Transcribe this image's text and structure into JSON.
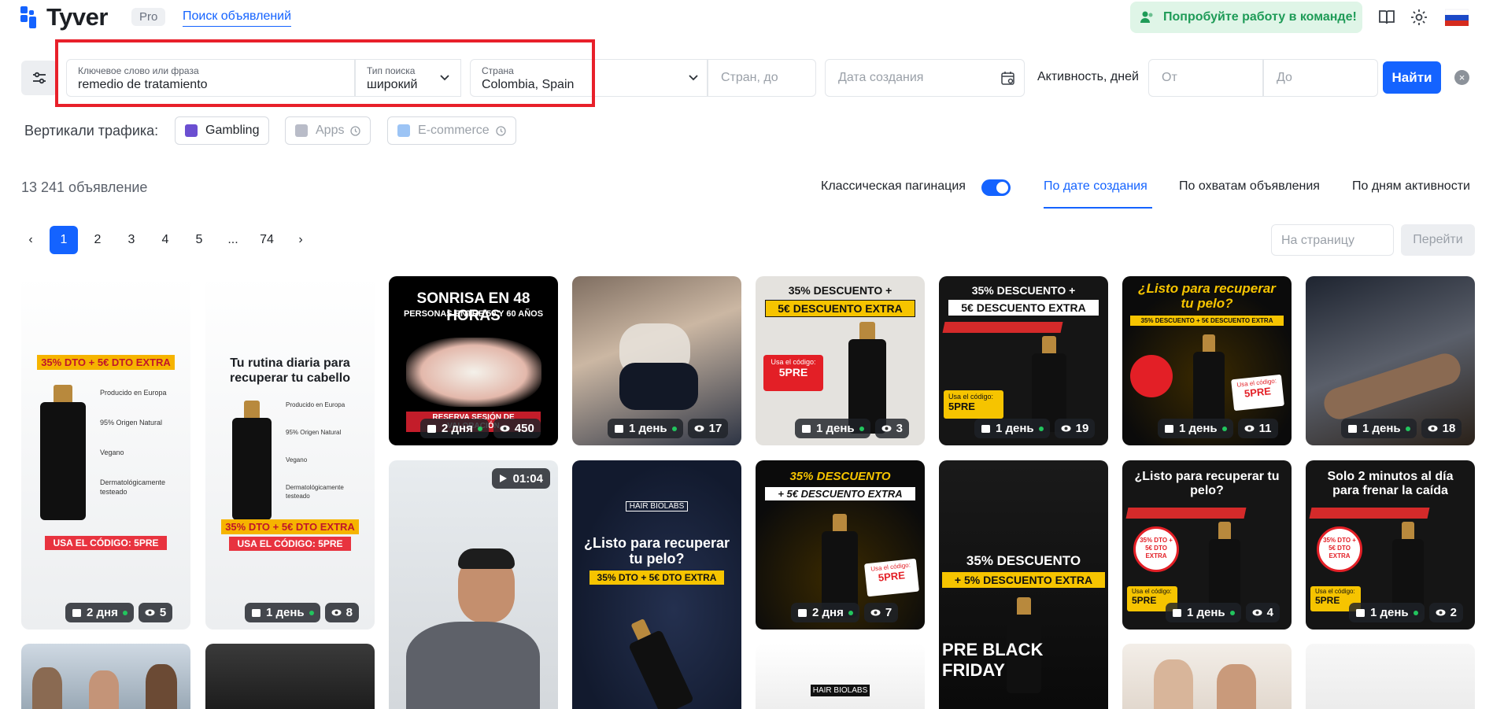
{
  "header": {
    "brand": "Tyver",
    "pro_badge": "Pro",
    "nav_link": "Поиск объявлений",
    "team_cta": "Попробуйте работу в команде!"
  },
  "filters": {
    "keyword": {
      "label": "Ключевое слово или фраза",
      "value": "remedio de tratamiento"
    },
    "search_type": {
      "label": "Тип поиска",
      "value": "широкий"
    },
    "country": {
      "label": "Страна",
      "value": "Colombia, Spain"
    },
    "countries_to_placeholder": "Стран, до",
    "created_date_placeholder": "Дата создания",
    "activity_label": "Активность, дней",
    "activity_from_placeholder": "От",
    "activity_to_placeholder": "До",
    "find_button": "Найти",
    "clear_icon": "×"
  },
  "verticals": {
    "label": "Вертикали трафика:",
    "items": [
      {
        "label": "Gambling",
        "enabled": true
      },
      {
        "label": "Apps",
        "enabled": false
      },
      {
        "label": "E-commerce",
        "enabled": false
      }
    ]
  },
  "results": {
    "count": "13 241 объявление",
    "pagination_label": "Классическая пагинация",
    "pagination_toggle_on": true,
    "sort_options": [
      "По дате создания",
      "По охватам объявления",
      "По дням активности"
    ],
    "active_sort": "По дате создания"
  },
  "pagination": {
    "prev": "‹",
    "next": "›",
    "pages": [
      "1",
      "2",
      "3",
      "4",
      "5",
      "...",
      "74"
    ],
    "current": "1",
    "per_page_placeholder": "На страницу",
    "go_button": "Перейти"
  },
  "cards": [
    {
      "top_text": "35% DTO + 5€ DTO EXTRA",
      "sub_lines": [
        "Producido en Europa",
        "95% Origen Natural",
        "Vegano",
        "Dermatológicamente testeado"
      ],
      "bottom_text": "USA EL CÓDIGO: 5PRE",
      "days": "2 дня",
      "views": "5"
    },
    {
      "top_text": "Tu rutina diaria para recuperar tu cabello",
      "sub_lines": [
        "Producido en Europa",
        "95% Origen Natural",
        "Vegano",
        "Dermatológicamente testeado"
      ],
      "extra_text": "35% DTO + 5€ DTO EXTRA",
      "bottom_text": "USA EL CÓDIGO: 5PRE",
      "days": "1 день",
      "views": "8"
    },
    {
      "top_text": "SONRISA EN 48 HORAS",
      "sub_text": "PERSONAS ENTRE 50 Y 60 AÑOS",
      "bottom_text": "RESERVA SESIÓN DE VALORACIÓN",
      "days": "2 дня",
      "views": "450"
    },
    {
      "days": "1 день",
      "views": "17"
    },
    {
      "top_text": "35% DESCUENTO +",
      "sub_text": "5€ DESCUENTO EXTRA",
      "code_label": "Usa el código:",
      "code": "5PRE",
      "days": "1 день",
      "views": "3"
    },
    {
      "top_text": "35% DESCUENTO +",
      "sub_text": "5€ DESCUENTO EXTRA",
      "code_label": "Usa el código:",
      "code": "5PRE",
      "days": "1 день",
      "views": "19"
    },
    {
      "top_text": "¿Listo para recuperar tu pelo?",
      "sub_text": "35% DESCUENTO + 5€ DESCUENTO EXTRA",
      "code_label": "Usa el código:",
      "code": "5PRE",
      "days": "1 день",
      "views": "11"
    },
    {
      "days": "1 день",
      "views": "18"
    },
    {
      "duration": "01:04"
    },
    {
      "brand": "HAIR BIOLABS",
      "top_text": "¿Listo para recuperar tu pelo?",
      "sub_text": "35% DTO + 5€ DTO EXTRA"
    },
    {
      "top_text": "35% DESCUENTO",
      "sub_text": "+ 5€ DESCUENTO EXTRA",
      "code_label": "Usa el código:",
      "code": "5PRE",
      "days": "2 дня",
      "views": "7"
    },
    {
      "top_text": "35% DESCUENTO",
      "sub_text": "+ 5% DESCUENTO EXTRA",
      "bottom_text": "PRE BLACK FRIDAY"
    },
    {
      "top_text": "¿Listo para recuperar tu pelo?",
      "badge": "35% DTO + 5€ DTO EXTRA",
      "code_label": "Usa el código:",
      "code": "5PRE",
      "days": "1 день",
      "views": "4"
    },
    {
      "top_text": "Solo 2 minutos al día para frenar la caída",
      "badge": "35% DTO + 5€ DTO EXTRA",
      "code_label": "Usa el código:",
      "code": "5PRE",
      "days": "1 день",
      "views": "2"
    },
    {
      "brand": "HAIR BIOLABS"
    }
  ],
  "colors": {
    "accent": "#1463ff",
    "success": "#1e9b57",
    "highlight": "#e8202a"
  }
}
